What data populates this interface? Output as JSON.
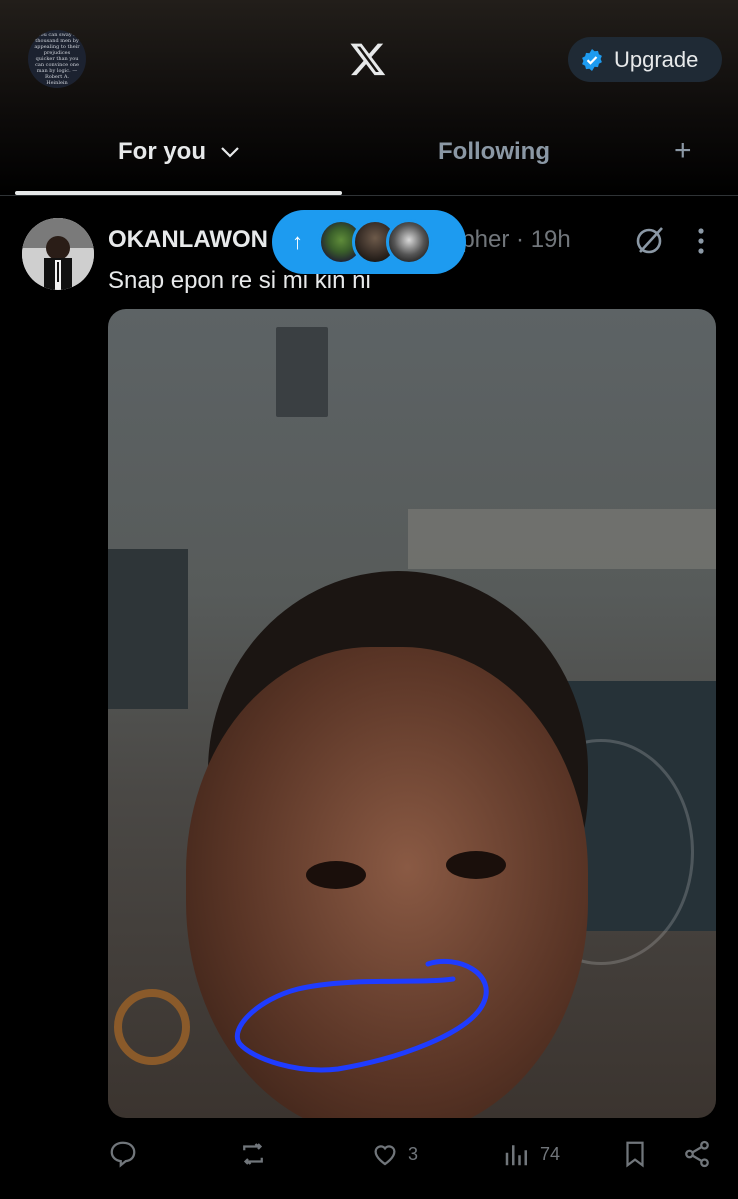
{
  "header": {
    "profile_quote": "You can sway a thousand men by appealing to their prejudices quicker than you can convince one man by logic. — Robert A. Heinlein",
    "upgrade_label": "Upgrade"
  },
  "tabs": {
    "for_you": "For you",
    "following": "Following",
    "add": "+"
  },
  "new_posts_pill": {
    "arrow": "↑"
  },
  "post": {
    "author_name": "OKANLAWON",
    "author_meta_visible": "pher · 19h",
    "text": "Snap epon re si mi kin ni",
    "stats": {
      "likes": "3",
      "views": "74"
    }
  },
  "colors": {
    "accent": "#1d9bf0",
    "scribble": "#1f3cff"
  }
}
